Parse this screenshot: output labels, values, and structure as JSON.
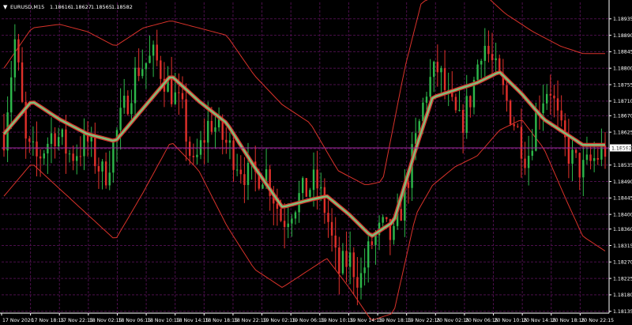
{
  "header": {
    "symbol": "EURUSD,M15",
    "open": "1.18616",
    "high": "1.18627",
    "low": "1.18565",
    "close": "1.18582"
  },
  "chart_data": {
    "type": "candlestick",
    "symbol": "EURUSD",
    "timeframe": "M15",
    "colors": {
      "background": "#000000",
      "grid": "#4b0f4b",
      "bull_candle": "#2db84a",
      "bear_candle": "#e0302a",
      "bands": "#d8322a",
      "midline": "#7fbf7a",
      "current_price_line": "#9b2a9b",
      "axis_text": "#ffffff"
    },
    "y_axis": {
      "min": 1.1813,
      "max": 1.1898,
      "ticks": [
        "1.18935",
        "1.18890",
        "1.18845",
        "1.18800",
        "1.18755",
        "1.18710",
        "1.18670",
        "1.18625",
        "1.18580",
        "1.18535",
        "1.18490",
        "1.18445",
        "1.18400",
        "1.18360",
        "1.18315",
        "1.18270",
        "1.18225",
        "1.18180",
        "1.18135"
      ]
    },
    "x_axis": {
      "ticks": [
        "17 Nov 2020",
        "17 Nov 18:15",
        "17 Nov 22:15",
        "18 Nov 02:15",
        "18 Nov 06:15",
        "18 Nov 10:15",
        "18 Nov 14:15",
        "18 Nov 18:15",
        "18 Nov 22:15",
        "19 Nov 02:15",
        "19 Nov 06:15",
        "19 Nov 10:15",
        "19 Nov 14:15",
        "19 Nov 18:15",
        "19 Nov 22:15",
        "20 Nov 02:15",
        "20 Nov 06:15",
        "20 Nov 10:15",
        "20 Nov 14:15",
        "20 Nov 18:15",
        "20 Nov 22:15"
      ]
    },
    "current_price": "1.18582",
    "price_path": [
      [
        0,
        1.1862
      ],
      [
        2,
        1.1888
      ],
      [
        4,
        1.1858
      ],
      [
        6,
        1.1855
      ],
      [
        9,
        1.1863
      ],
      [
        12,
        1.1856
      ],
      [
        15,
        1.186
      ],
      [
        18,
        1.185
      ],
      [
        21,
        1.1866
      ],
      [
        24,
        1.188
      ],
      [
        27,
        1.1883
      ],
      [
        30,
        1.1874
      ],
      [
        32,
        1.1868
      ],
      [
        34,
        1.1852
      ],
      [
        37,
        1.1866
      ],
      [
        41,
        1.1857
      ],
      [
        44,
        1.185
      ],
      [
        47,
        1.1852
      ],
      [
        50,
        1.1838
      ],
      [
        52,
        1.1843
      ],
      [
        56,
        1.1849
      ],
      [
        58,
        1.184
      ],
      [
        60,
        1.1824
      ],
      [
        62,
        1.1828
      ],
      [
        64,
        1.1822
      ],
      [
        66,
        1.1832
      ],
      [
        68,
        1.1836
      ],
      [
        70,
        1.1833
      ],
      [
        72,
        1.1846
      ],
      [
        74,
        1.186
      ],
      [
        76,
        1.1875
      ],
      [
        78,
        1.188
      ],
      [
        80,
        1.187
      ],
      [
        82,
        1.1864
      ],
      [
        84,
        1.1873
      ],
      [
        86,
        1.1888
      ],
      [
        88,
        1.188
      ],
      [
        90,
        1.1872
      ],
      [
        92,
        1.1864
      ],
      [
        94,
        1.1855
      ],
      [
        96,
        1.187
      ],
      [
        98,
        1.1876
      ],
      [
        100,
        1.1862
      ],
      [
        102,
        1.1855
      ],
      [
        104,
        1.1852
      ],
      [
        108,
        1.1858
      ]
    ],
    "midline": [
      [
        0,
        1.1862
      ],
      [
        5,
        1.1871
      ],
      [
        10,
        1.1866
      ],
      [
        15,
        1.1862
      ],
      [
        20,
        1.186
      ],
      [
        25,
        1.1869
      ],
      [
        30,
        1.1878
      ],
      [
        35,
        1.1871
      ],
      [
        40,
        1.1865
      ],
      [
        45,
        1.1853
      ],
      [
        50,
        1.1842
      ],
      [
        55,
        1.1844
      ],
      [
        58,
        1.1845
      ],
      [
        62,
        1.184
      ],
      [
        66,
        1.1834
      ],
      [
        70,
        1.1838
      ],
      [
        74,
        1.1858
      ],
      [
        77,
        1.1872
      ],
      [
        81,
        1.1874
      ],
      [
        85,
        1.1876
      ],
      [
        89,
        1.1879
      ],
      [
        93,
        1.1873
      ],
      [
        97,
        1.1866
      ],
      [
        101,
        1.1862
      ],
      [
        104,
        1.1859
      ],
      [
        108,
        1.1859
      ]
    ],
    "upper_band": [
      [
        0,
        1.188
      ],
      [
        5,
        1.1891
      ],
      [
        10,
        1.1892
      ],
      [
        15,
        1.189
      ],
      [
        20,
        1.1886
      ],
      [
        25,
        1.1891
      ],
      [
        30,
        1.1893
      ],
      [
        35,
        1.1891
      ],
      [
        40,
        1.1889
      ],
      [
        45,
        1.1878
      ],
      [
        50,
        1.187
      ],
      [
        55,
        1.1865
      ],
      [
        60,
        1.1852
      ],
      [
        65,
        1.1848
      ],
      [
        68,
        1.1849
      ],
      [
        72,
        1.188
      ],
      [
        75,
        1.1898
      ],
      [
        78,
        1.19
      ],
      [
        82,
        1.1904
      ],
      [
        85,
        1.1902
      ],
      [
        90,
        1.1895
      ],
      [
        95,
        1.189
      ],
      [
        100,
        1.1886
      ],
      [
        104,
        1.1884
      ],
      [
        108,
        1.1884
      ]
    ],
    "lower_band": [
      [
        0,
        1.1845
      ],
      [
        5,
        1.1854
      ],
      [
        10,
        1.1847
      ],
      [
        15,
        1.184
      ],
      [
        20,
        1.1833
      ],
      [
        25,
        1.1846
      ],
      [
        30,
        1.186
      ],
      [
        35,
        1.1852
      ],
      [
        40,
        1.1837
      ],
      [
        45,
        1.1825
      ],
      [
        50,
        1.182
      ],
      [
        55,
        1.1825
      ],
      [
        58,
        1.1828
      ],
      [
        62,
        1.182
      ],
      [
        66,
        1.1811
      ],
      [
        70,
        1.1813
      ],
      [
        74,
        1.184
      ],
      [
        77,
        1.1848
      ],
      [
        81,
        1.1853
      ],
      [
        85,
        1.1856
      ],
      [
        89,
        1.1863
      ],
      [
        93,
        1.1866
      ],
      [
        97,
        1.1858
      ],
      [
        101,
        1.1844
      ],
      [
        104,
        1.1834
      ],
      [
        108,
        1.183
      ]
    ]
  }
}
